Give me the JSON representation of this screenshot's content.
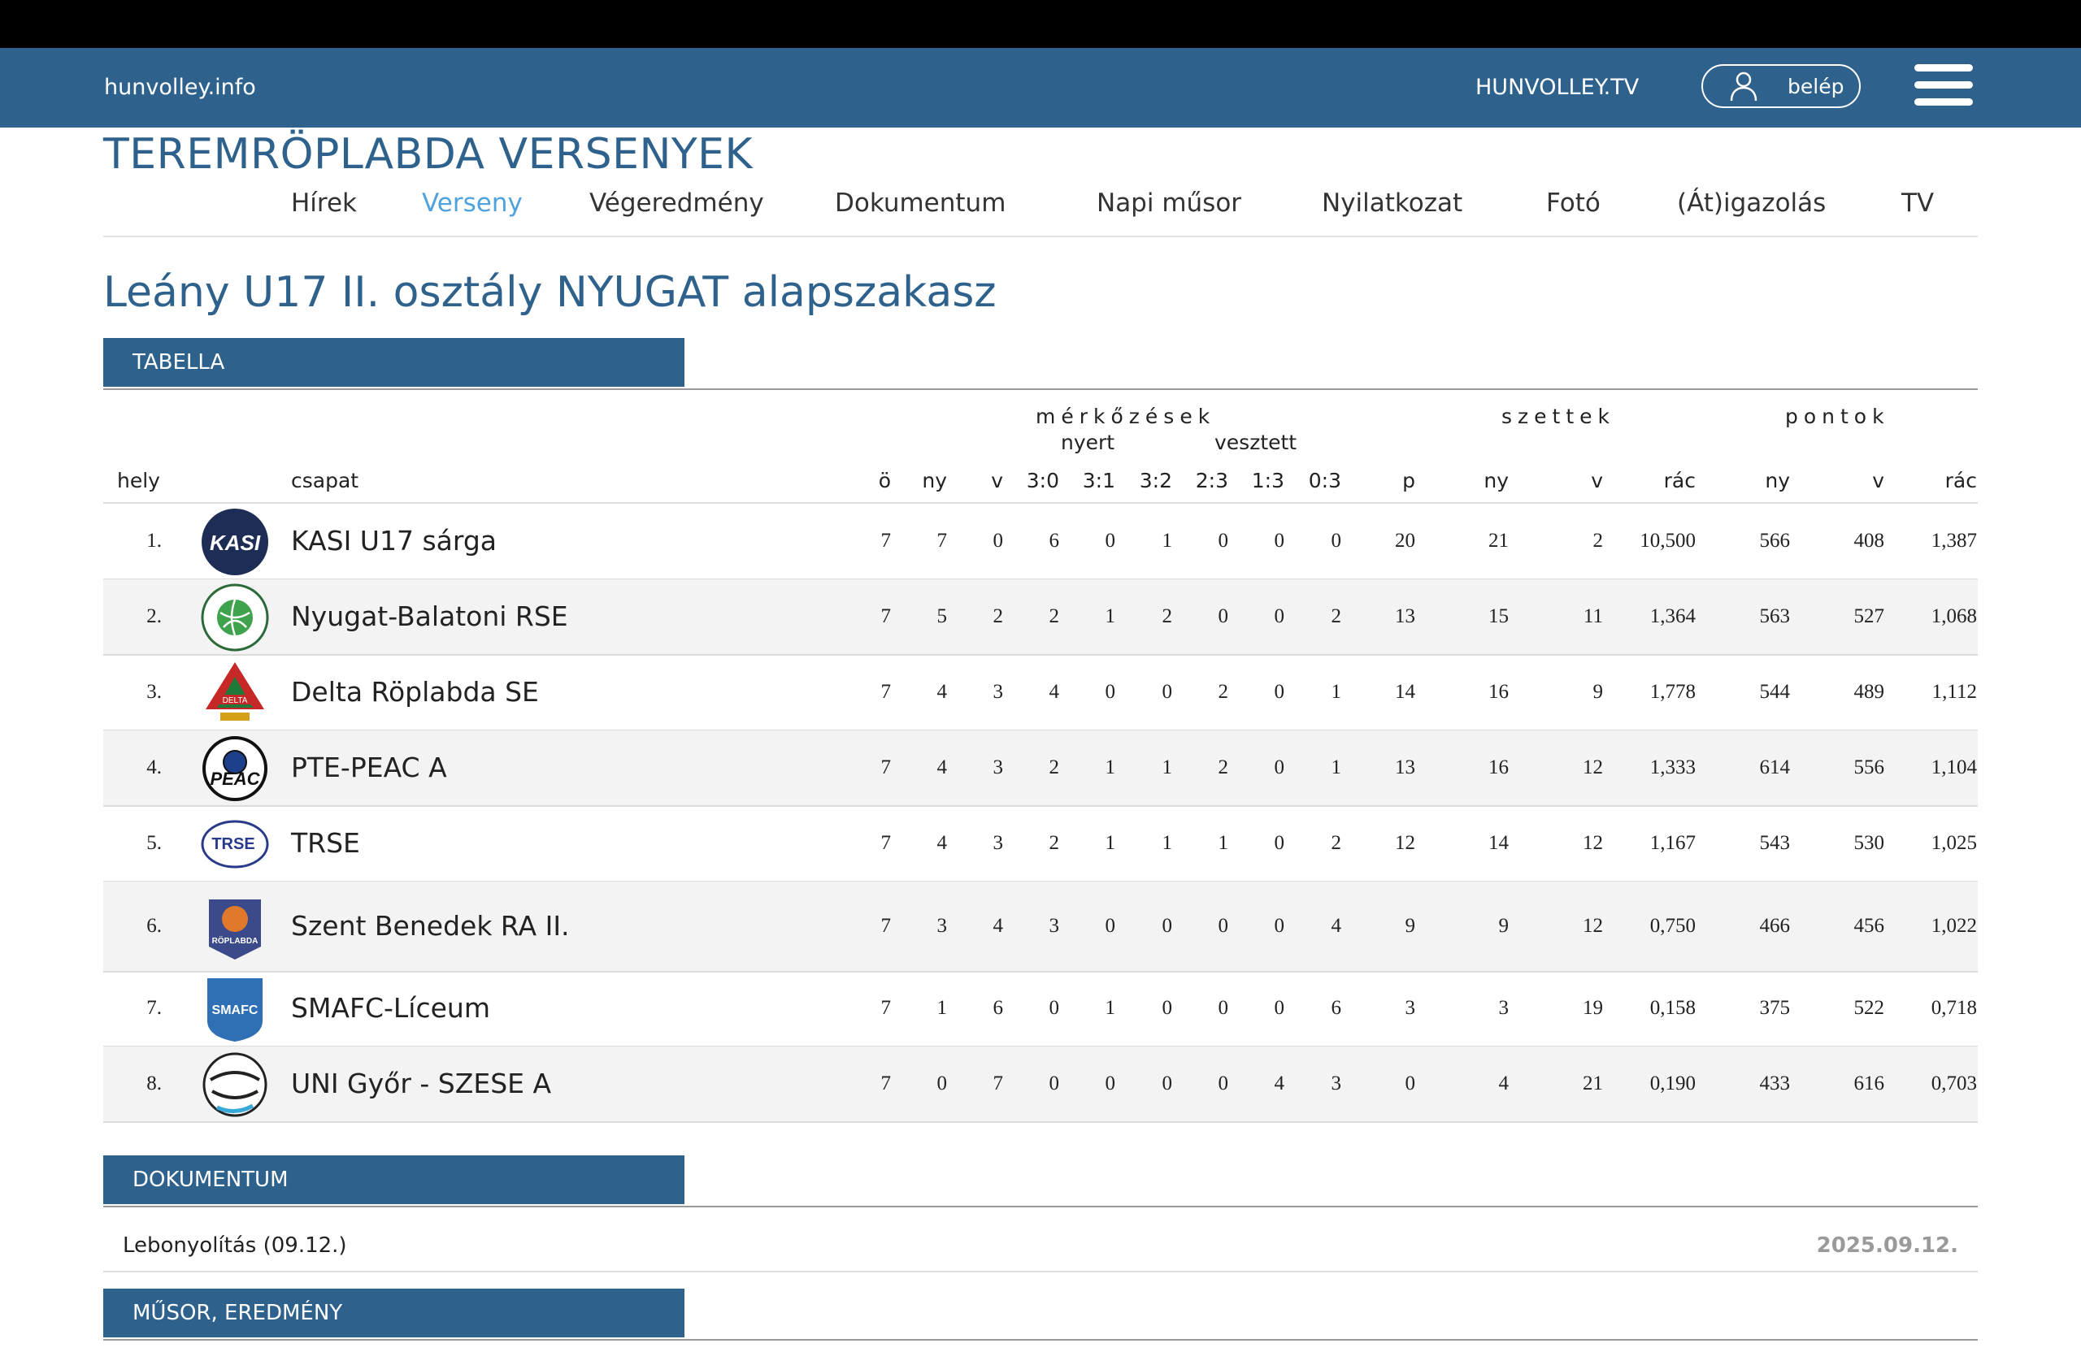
{
  "header": {
    "site_name": "hunvolley.info",
    "tv_link": "HUNVOLLEY.TV",
    "login_label": "belép",
    "brand_color": "#2e628c",
    "accent_color": "#4fa3dd"
  },
  "page_title": "TEREMRÖPLABDA VERSENYEK",
  "menu": {
    "items": [
      "Hírek",
      "Verseny",
      "Végeredmény",
      "Dokumentum",
      "Napi műsor",
      "Nyilatkozat",
      "Fotó",
      "(Át)igazolás",
      "TV"
    ],
    "active": "Verseny"
  },
  "competition_title": "Leány U17 II. osztály NYUGAT alapszakasz",
  "sections": {
    "table": "TABELLA",
    "documents": "DOKUMENTUM",
    "schedule": "MŰSOR, EREDMÉNY"
  },
  "table": {
    "groups": {
      "matches": "mérkőzések",
      "won": "nyert",
      "lost": "vesztett",
      "sets": "szettek",
      "points": "pontok"
    },
    "columns": [
      "hely",
      "csapat",
      "ö",
      "ny",
      "v",
      "3:0",
      "3:1",
      "3:2",
      "2:3",
      "1:3",
      "0:3",
      "p",
      "ny",
      "v",
      "rác",
      "ny",
      "v",
      "rác"
    ],
    "rows": [
      {
        "pos": "1.",
        "team": "KASI U17 sárga",
        "logo": "kasi-logo",
        "vals": [
          "7",
          "7",
          "0",
          "6",
          "0",
          "1",
          "0",
          "0",
          "0",
          "20",
          "21",
          "2",
          "10,500",
          "566",
          "408",
          "1,387"
        ]
      },
      {
        "pos": "2.",
        "team": "Nyugat-Balatoni RSE",
        "logo": "nybrse-logo",
        "vals": [
          "7",
          "5",
          "2",
          "2",
          "1",
          "2",
          "0",
          "0",
          "2",
          "13",
          "15",
          "11",
          "1,364",
          "563",
          "527",
          "1,068"
        ]
      },
      {
        "pos": "3.",
        "team": "Delta Röplabda SE",
        "logo": "delta-logo",
        "vals": [
          "7",
          "4",
          "3",
          "4",
          "0",
          "0",
          "2",
          "0",
          "1",
          "14",
          "16",
          "9",
          "1,778",
          "544",
          "489",
          "1,112"
        ]
      },
      {
        "pos": "4.",
        "team": "PTE-PEAC A",
        "logo": "peac-logo",
        "vals": [
          "7",
          "4",
          "3",
          "2",
          "1",
          "1",
          "2",
          "0",
          "1",
          "13",
          "16",
          "12",
          "1,333",
          "614",
          "556",
          "1,104"
        ]
      },
      {
        "pos": "5.",
        "team": "TRSE",
        "logo": "trse-logo",
        "vals": [
          "7",
          "4",
          "3",
          "2",
          "1",
          "1",
          "1",
          "0",
          "2",
          "12",
          "14",
          "12",
          "1,167",
          "543",
          "530",
          "1,025"
        ]
      },
      {
        "pos": "6.",
        "team": "Szent Benedek RA II.",
        "logo": "szent-benedek-logo",
        "vals": [
          "7",
          "3",
          "4",
          "3",
          "0",
          "0",
          "0",
          "0",
          "4",
          "9",
          "9",
          "12",
          "0,750",
          "466",
          "456",
          "1,022"
        ]
      },
      {
        "pos": "7.",
        "team": "SMAFC-Líceum",
        "logo": "smafc-logo",
        "vals": [
          "7",
          "1",
          "6",
          "0",
          "1",
          "0",
          "0",
          "0",
          "6",
          "3",
          "3",
          "19",
          "0,158",
          "375",
          "522",
          "0,718"
        ]
      },
      {
        "pos": "8.",
        "team": "UNI Győr - SZESE A",
        "logo": "uni-gyor-logo",
        "vals": [
          "7",
          "0",
          "7",
          "0",
          "0",
          "0",
          "0",
          "4",
          "3",
          "0",
          "4",
          "21",
          "0,190",
          "433",
          "616",
          "0,703"
        ]
      }
    ]
  },
  "documents": [
    {
      "name": "Lebonyolítás (09.12.)",
      "date": "2025.09.12."
    }
  ]
}
